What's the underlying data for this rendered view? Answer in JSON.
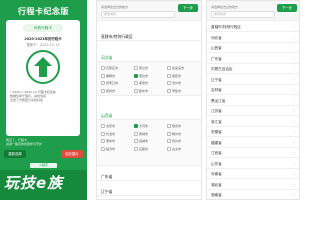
{
  "left_screen": {
    "title": "行程卡纪念版",
    "badge": "你的行程卡",
    "range_line": "2020-2023年的行程卡",
    "date_line": "更新于：2022.12.13",
    "notes": [
      "* 2020.1–2022.12 行程卡纪念版",
      "数据仅用于展示，请勿当真",
      "点击下方按钮分享给好友"
    ],
    "footer_lines": [
      "再见了，行程卡",
      "感谢一路有你的陪伴与守护"
    ],
    "left_button": "重新选择",
    "right_button": "保存图片",
    "tag": "小程序",
    "brand": "玩技e族",
    "arrow_icon": "up-arrow-icon",
    "accent_color": "#1e9e4a"
  },
  "middle_screen": {
    "header_select": "请选择您去过的地方",
    "search_placeholder": "搜索城市",
    "next_button": "下一步",
    "sections": [
      {
        "label": "直辖市/特别行政区",
        "chevron": "›"
      },
      {
        "label": "河北省",
        "chevron": "⌄"
      },
      {
        "label": "山西省",
        "chevron": "⌄"
      },
      {
        "label": "广东省",
        "chevron": "›"
      },
      {
        "label": "辽宁省",
        "chevron": "›"
      }
    ],
    "grid_a": [
      "石家庄市",
      "唐山市",
      "秦皇岛市",
      "邯郸市",
      "邢台市",
      "保定市",
      "张家口市",
      "承德市",
      "沧州市",
      "廊坊市",
      "衡水市",
      "辛集市"
    ],
    "grid_b": [
      "太原市",
      "大同市",
      "阳泉市",
      "长治市",
      "晋城市",
      "朔州市",
      "晋中市",
      "运城市",
      "忻州市",
      "临汾市",
      "吕梁市",
      "古交市"
    ]
  },
  "right_screen": {
    "header_select": "请选择您去过的地方",
    "search_placeholder": "搜索城市",
    "next_button": "下一步",
    "provinces": [
      "直辖市/特别行政区",
      "河北省",
      "山西省",
      "广东省",
      "内蒙古自治区",
      "辽宁省",
      "吉林省",
      "黑龙江省",
      "江苏省",
      "浙江省",
      "安徽省",
      "福建省",
      "江西省",
      "山东省",
      "河南省",
      "湖北省",
      "湖南省"
    ],
    "chevron": "›"
  }
}
